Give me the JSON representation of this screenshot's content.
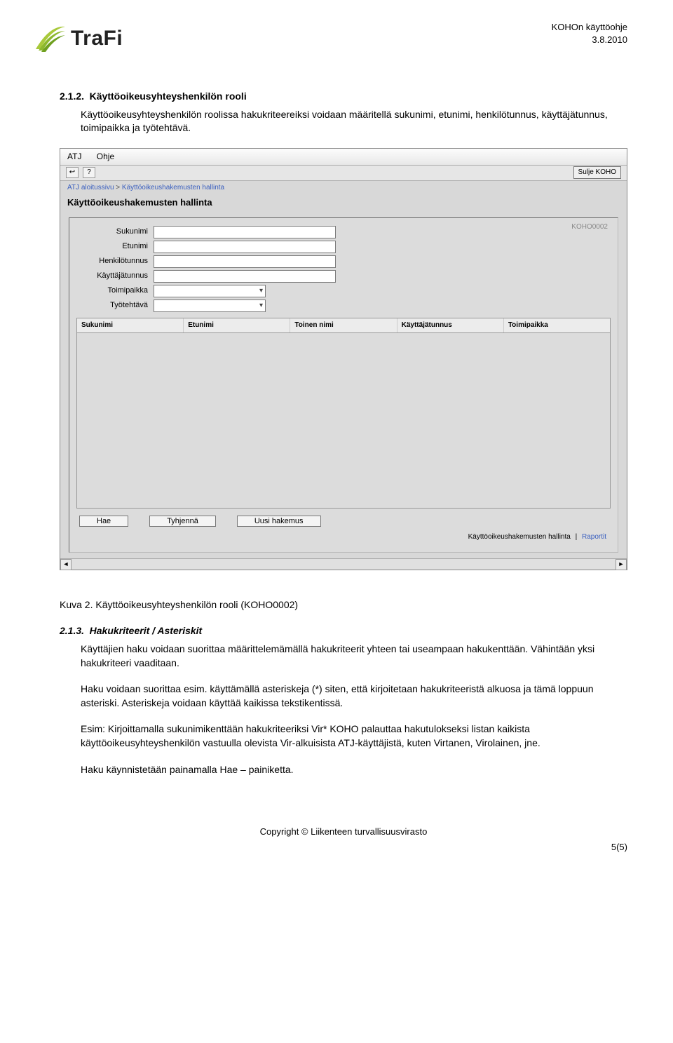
{
  "doc": {
    "header_right_1": "KOHOn käyttöohje",
    "header_right_2": "3.8.2010",
    "logo_text": "TraFi",
    "sec1_num": "2.1.2.",
    "sec1_title": "Käyttöoikeusyhteyshenkilön rooli",
    "para1": "Käyttöoikeusyhteyshenkilön roolissa hakukriteereiksi voidaan määritellä sukunimi, etunimi, henkilötunnus, käyttäjätunnus, toimipaikka ja työtehtävä.",
    "caption": "Kuva 2. Käyttöoikeusyhteyshenkilön rooli (KOHO0002)",
    "sec2_num": "2.1.3.",
    "sec2_title": "Hakukriteerit / Asteriskit",
    "para2": "Käyttäjien haku voidaan suorittaa määrittelemämällä hakukriteerit yhteen tai useampaan hakukenttään. Vähintään yksi hakukriteeri vaaditaan.",
    "para3": "Haku voidaan suorittaa esim. käyttämällä asteriskeja (*) siten, että kirjoitetaan hakukriteeristä alkuosa ja tämä loppuun asteriski. Asteriskeja voidaan käyttää kaikissa tekstikentissä.",
    "para4": "Esim: Kirjoittamalla sukunimikenttään hakukriteeriksi  Vir*  KOHO palauttaa hakutulokseksi listan kaikista käyttöoikeusyhteyshenkilön vastuulla olevista Vir-alkuisista ATJ-käyttäjistä, kuten Virtanen, Virolainen, jne.",
    "para5": "Haku käynnistetään painamalla Hae – painiketta.",
    "footer": "Copyright © Liikenteen turvallisuusvirasto",
    "page": "5(5)"
  },
  "app": {
    "menu1": "ATJ",
    "menu2": "Ohje",
    "btn_back": "↩",
    "btn_help": "?",
    "btn_close": "Sulje KOHO",
    "crumb_home": "ATJ aloitussivu",
    "crumb_sep": " > ",
    "crumb_here": "Käyttöoikeushakemusten hallinta",
    "title": "Käyttöoikeushakemusten hallinta",
    "screen_id": "KOHO0002",
    "labels": {
      "sukunimi": "Sukunimi",
      "etunimi": "Etunimi",
      "henkilotunnus": "Henkilötunnus",
      "kayttajatunnus": "Käyttäjätunnus",
      "toimipaikka": "Toimipaikka",
      "tyotehtava": "Työtehtävä"
    },
    "cols": [
      "Sukunimi",
      "Etunimi",
      "Toinen nimi",
      "Käyttäjätunnus",
      "Toimipaikka"
    ],
    "btn_hae": "Hae",
    "btn_tyhjenna": "Tyhjennä",
    "btn_uusi": "Uusi hakemus",
    "tab1": "Käyttöoikeushakemusten hallinta",
    "tab2": "Raportit"
  }
}
